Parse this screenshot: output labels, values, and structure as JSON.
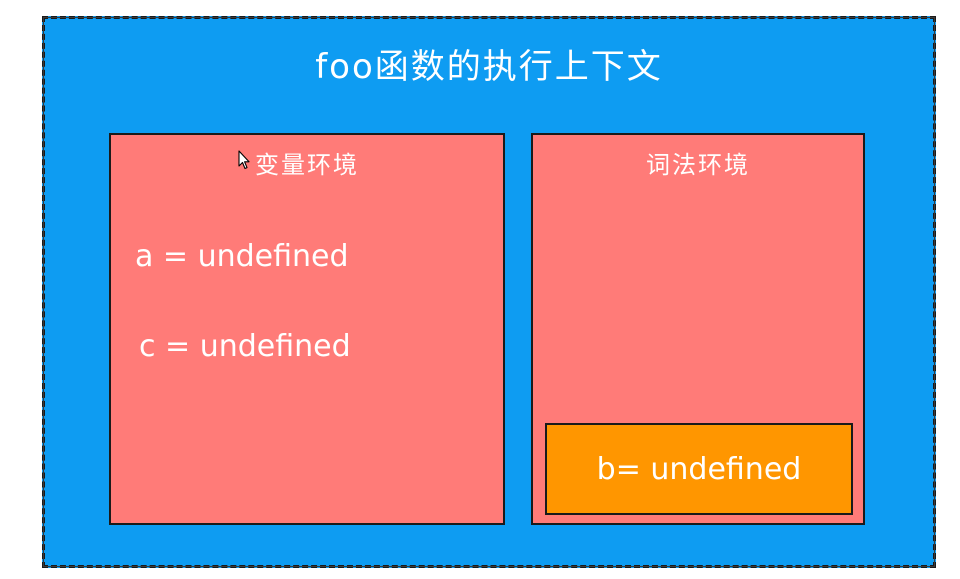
{
  "diagram": {
    "title": "foo函数的执行上下文",
    "variable_environment": {
      "title": "变量环境",
      "entries": [
        "a = undefined",
        "c = undefined"
      ]
    },
    "lexical_environment": {
      "title": "词法环境",
      "block": {
        "entries": [
          "b= undefined"
        ]
      }
    }
  },
  "colors": {
    "outer_background": "#0e9cf2",
    "environment_background": "#ff7b78",
    "block_background": "#ff9600",
    "text": "#ffffff",
    "border": "#1a1a1a"
  },
  "icons": {
    "cursor": "mouse-pointer-icon"
  }
}
